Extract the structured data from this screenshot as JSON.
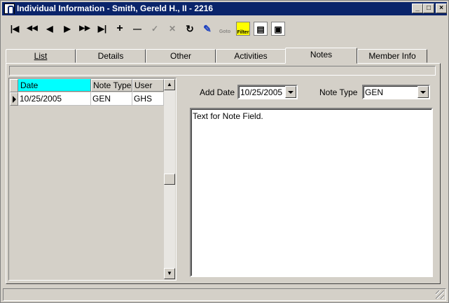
{
  "window": {
    "title": "Individual Information - Smith, Gereld H., II - 2216"
  },
  "title_buttons": {
    "minimize": "_",
    "maximize": "□",
    "close": "×"
  },
  "toolbar": {
    "first": "|◀",
    "prev_page": "◀◀",
    "prev": "◀",
    "next": "▶",
    "next_page": "▶▶",
    "last": "▶|",
    "add": "+",
    "delete": "—",
    "save": "✓",
    "cancel": "✕",
    "refresh": "↻",
    "find": "✎",
    "goto": "Goto",
    "filter": "Filter",
    "print_preview": "▤",
    "print": "▣"
  },
  "tabs": [
    {
      "label": "List"
    },
    {
      "label": "Details"
    },
    {
      "label": "Other"
    },
    {
      "label": "Activities"
    },
    {
      "label": "Notes"
    },
    {
      "label": "Member Info"
    }
  ],
  "grid": {
    "columns": [
      "Date",
      "Note Type",
      "User"
    ],
    "rows": [
      {
        "date": "10/25/2005",
        "note_type": "GEN",
        "user": "GHS"
      }
    ]
  },
  "form": {
    "add_date_label": "Add Date",
    "add_date_value": "10/25/2005",
    "note_type_label": "Note Type",
    "note_type_value": "GEN",
    "note_text": "Text for Note Field."
  },
  "colors": {
    "title_bg": "#0a246a",
    "face": "#d4d0c8",
    "selected_header": "#00ffff"
  }
}
